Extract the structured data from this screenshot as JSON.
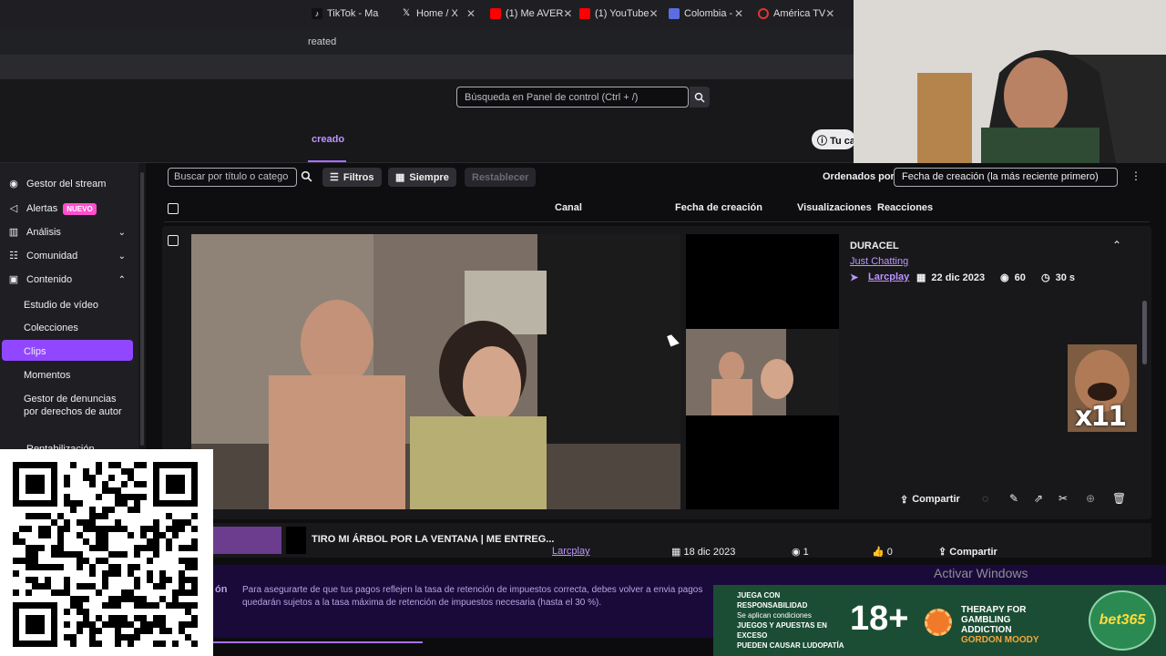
{
  "browser": {
    "tabs": [
      {
        "label": "TikTok - Ma",
        "icon": "tiktok-icon",
        "color": "#111111"
      },
      {
        "label": "Home / X",
        "icon": "x-icon",
        "color": "#111111"
      },
      {
        "label": "(1) Me AVER",
        "icon": "youtube-icon",
        "color": "#ff0000"
      },
      {
        "label": "(1) YouTube",
        "icon": "youtube-icon",
        "color": "#ff0000"
      },
      {
        "label": "Colombia -",
        "icon": "tab-icon",
        "color": "#5b6ee1"
      },
      {
        "label": "América TV",
        "icon": "tab-icon",
        "color": "#e3342f"
      }
    ],
    "bookmark_text": "reated"
  },
  "dashboard": {
    "search_placeholder": "Búsqueda en Panel de control (Ctrl + /)",
    "subtab_label": "creado",
    "channel_button": "Tu ca"
  },
  "sidebar": {
    "items": [
      {
        "label": "Gestor del stream",
        "icon": "stream-icon"
      },
      {
        "label": "Alertas",
        "icon": "megaphone-icon",
        "badge": "NUEVO"
      },
      {
        "label": "Análisis",
        "icon": "chart-icon"
      },
      {
        "label": "Comunidad",
        "icon": "community-icon"
      },
      {
        "label": "Contenido",
        "icon": "content-icon"
      }
    ],
    "subitems": [
      "Estudio de vídeo",
      "Colecciones",
      "Clips",
      "Momentos",
      "Gestor de denuncias por derechos de autor"
    ],
    "active": "Clips",
    "cut_item": "Rentabilización"
  },
  "filters": {
    "search_placeholder": "Buscar por título o catego",
    "filters_label": "Filtros",
    "time_label": "Siempre",
    "reset_label": "Restablecer",
    "sort_label": "Ordenados por",
    "sort_value": "Fecha de creación (la más reciente primero)"
  },
  "table": {
    "headers": [
      "Canal",
      "Fecha de creación",
      "Visualizaciones",
      "Reacciones"
    ]
  },
  "clip": {
    "title": "DURACEL",
    "game": "Just Chatting",
    "channel": "Larcplay",
    "date": "22 dic 2023",
    "views": "60",
    "duration": "30 s",
    "share_label": "Compartir"
  },
  "row2": {
    "title": "TIRO MI ÁRBOL POR LA VENTANA | ME ENTREG...",
    "channel": "Larcplay",
    "date": "18 dic 2023",
    "views": "1",
    "reactions": "0",
    "share_label": "Compartir"
  },
  "banner": {
    "prefix": "ón",
    "text": "Para asegurarte de que tus pagos reflejen la tasa de retención de impuestos correcta, debes volver a envia pagos quedarán sujetos a la tasa máxima de retención de impuestos necesaria (hasta el 30 %)."
  },
  "watermark": "Activar Windows",
  "overlay": {
    "meme_text": "x11"
  },
  "ad": {
    "left_lines": [
      "JUEGA CON RESPONSABILIDAD",
      "Se aplican condiciones",
      "JUEGOS Y APUESTAS EN EXCESO",
      "PUEDEN CAUSAR LUDOPATÍA"
    ],
    "age": "18+",
    "therapy": "THERAPY FOR GAMBLING ADDICTION",
    "charity": "GORDON MOODY",
    "brand": "bet365"
  }
}
